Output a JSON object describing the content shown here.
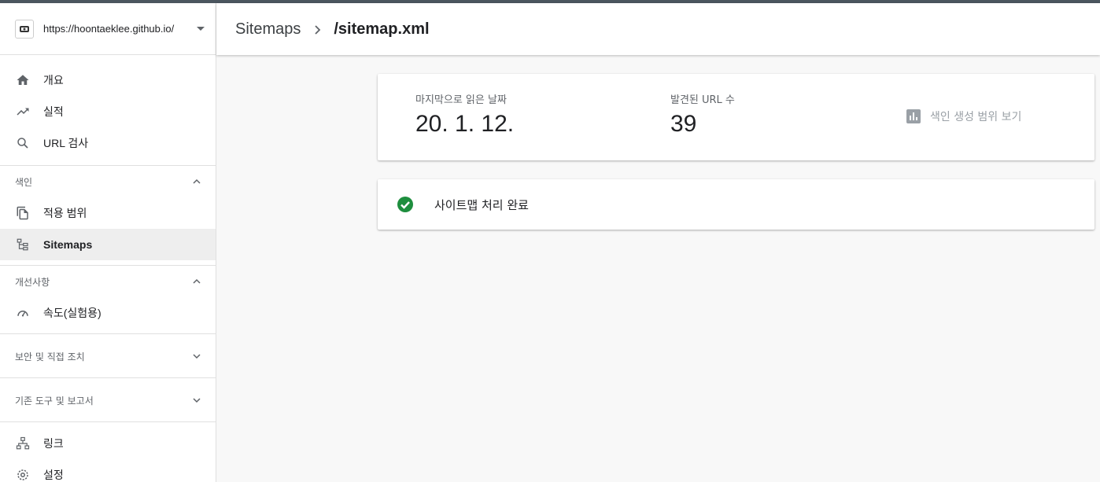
{
  "property": {
    "url": "https://hoontaeklee.github.io/"
  },
  "nav_top": [
    {
      "label": "개요",
      "icon": "home-icon"
    },
    {
      "label": "실적",
      "icon": "trending-up-icon"
    },
    {
      "label": "URL 검사",
      "icon": "search-icon"
    }
  ],
  "index_section": {
    "title": "색인",
    "items": [
      {
        "label": "적용 범위",
        "icon": "copy-pages-icon"
      },
      {
        "label": "Sitemaps",
        "icon": "sitemap-tree-icon"
      }
    ]
  },
  "enhancements_section": {
    "title": "개선사항",
    "items": [
      {
        "label": "속도(실험용)",
        "icon": "speedometer-icon"
      }
    ]
  },
  "security_section": {
    "title": "보안 및 직접 조치"
  },
  "legacy_section": {
    "title": "기존 도구 및 보고서"
  },
  "nav_bottom": [
    {
      "label": "링크",
      "icon": "links-icon"
    },
    {
      "label": "설정",
      "icon": "settings-icon"
    }
  ],
  "breadcrumb": {
    "parent": "Sitemaps",
    "current": "/sitemap.xml"
  },
  "stats": {
    "last_read_label": "마지막으로 읽은 날짜",
    "last_read_value": "20. 1. 12.",
    "discovered_label": "발견된 URL 수",
    "discovered_value": "39",
    "coverage_link": "색인 생성 범위 보기"
  },
  "status": {
    "text": "사이트맵 처리 완료",
    "color": "#1e8e3e"
  },
  "colors": {
    "topline": "#4b565f",
    "active_bg": "#eeeeee",
    "success": "#1e8e3e"
  }
}
